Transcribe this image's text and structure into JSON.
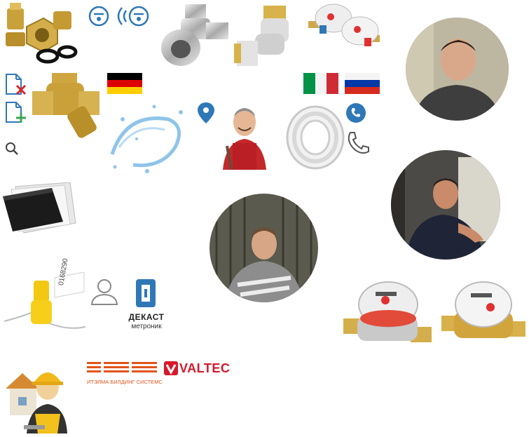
{
  "brands": {
    "dekast_name": "ДЕКАСТ",
    "dekast_sub": "метроник",
    "itelma_text": "ИТЭЛМА БИЛДИНГ СИСТЕМС",
    "valtec_text": "VALTEC"
  },
  "seal_tag_text": "0168290",
  "flags": {
    "germany": [
      "#000000",
      "#dd0000",
      "#ffce00"
    ],
    "italy": [
      "#009246",
      "#ffffff",
      "#ce2b37"
    ],
    "russia": [
      "#ffffff",
      "#0039a6",
      "#d52b1e"
    ]
  },
  "colors": {
    "accent": "#2f78b7",
    "add_green": "#3aa655",
    "remove_red": "#d9262b",
    "valtec_red": "#d7182a",
    "itelma_orange": "#e2541c"
  }
}
